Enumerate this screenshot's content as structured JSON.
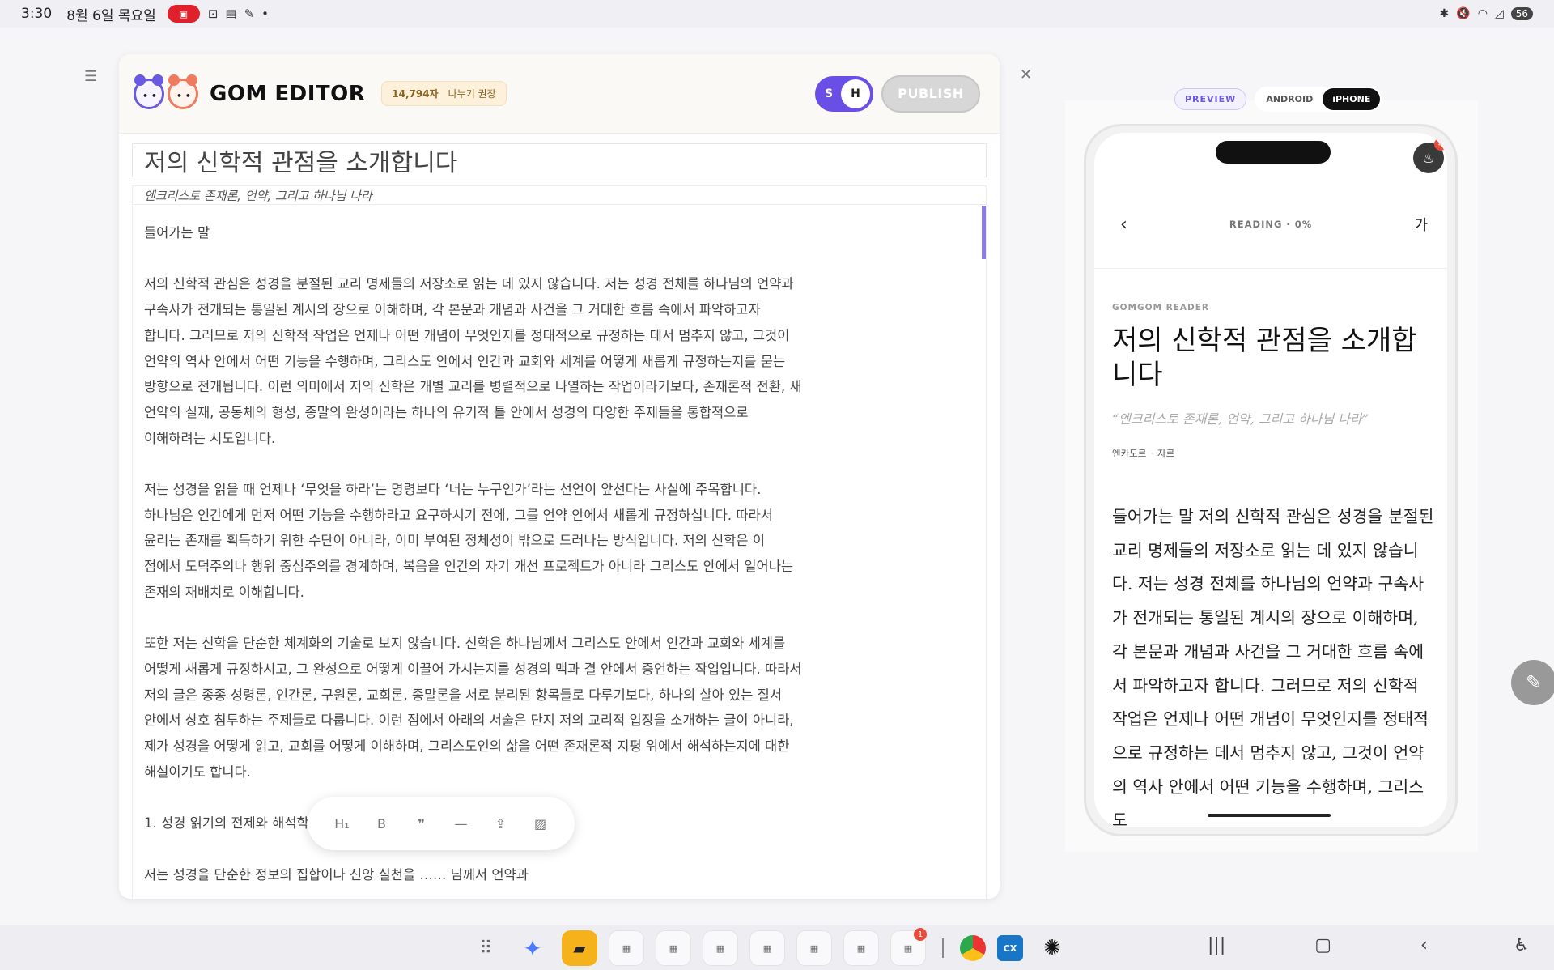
{
  "status_bar": {
    "time": "3:30",
    "date": "8월 6일 목요일",
    "battery": "56"
  },
  "editor": {
    "logo": "GOM EDITOR",
    "word_count": "14,794자",
    "font_hint": "나누기 권장",
    "toggle": {
      "left": "S",
      "right": "H"
    },
    "publish_label": "PUBLISH",
    "title": "저의 신학적 관점을 소개합니다",
    "subtitle": "엔크리스토 존재론, 언약, 그리고 하나님 나라",
    "paragraphs": [
      "들어가는 말",
      "저의 신학적 관심은 성경을 분절된 교리 명제들의 저장소로 읽는 데 있지 않습니다. 저는 성경 전체를 하나님의 언약과\n구속사가 전개되는 통일된 계시의 장으로 이해하며, 각 본문과 개념과 사건을 그 거대한 흐름 속에서 파악하고자\n합니다. 그러므로 저의 신학적 작업은 언제나 어떤 개념이 무엇인지를 정태적으로 규정하는 데서 멈추지 않고, 그것이\n언약의 역사 안에서 어떤 기능을 수행하며, 그리스도 안에서 인간과 교회와 세계를 어떻게 새롭게 규정하는지를 묻는\n방향으로 전개됩니다. 이런 의미에서 저의 신학은 개별 교리를 병렬적으로 나열하는 작업이라기보다, 존재론적 전환, 새\n언약의 실재, 공동체의 형성, 종말의 완성이라는 하나의 유기적 틀 안에서 성경의 다양한 주제들을 통합적으로\n이해하려는 시도입니다.",
      "저는 성경을 읽을 때 언제나 ‘무엇을 하라’는 명령보다 ‘너는 누구인가’라는 선언이 앞선다는 사실에 주목합니다.\n하나님은 인간에게 먼저 어떤 기능을 수행하라고 요구하시기 전에, 그를 언약 안에서 새롭게 규정하십니다. 따라서\n윤리는 존재를 획득하기 위한 수단이 아니라, 이미 부여된 정체성이 밖으로 드러나는 방식입니다. 저의 신학은 이\n점에서 도덕주의나 행위 중심주의를 경계하며, 복음을 인간의 자기 개선 프로젝트가 아니라 그리스도 안에서 일어나는\n존재의 재배치로 이해합니다.",
      "또한 저는 신학을 단순한 체계화의 기술로 보지 않습니다. 신학은 하나님께서 그리스도 안에서 인간과 교회와 세계를\n어떻게 새롭게 규정하시고, 그 완성으로 어떻게 이끌어 가시는지를 성경의 맥과 결 안에서 증언하는 작업입니다. 따라서\n저의 글은 종종 성령론, 인간론, 구원론, 교회론, 종말론을 서로 분리된 항목들로 다루기보다, 하나의 살아 있는 질서\n안에서 상호 침투하는 주제들로 다룹니다. 이런 점에서 아래의 서술은 단지 저의 교리적 입장을 소개하는 글이 아니라,\n제가 성경을 어떻게 읽고, 교회를 어떻게 이해하며, 그리스도인의 삶을 어떤 존재론적 지평 위에서 해석하는지에 대한\n해설이기도 합니다.",
      "1. 성경 읽기의 전제와 해석학적 방법",
      "저는 성경을 단순한 정보의 집합이나 신앙 실천을 …… 님께서 언약과"
    ],
    "toolbar": [
      "H1",
      "B",
      "99",
      "—",
      "upload",
      "image"
    ]
  },
  "preview": {
    "preview_label": "PREVIEW",
    "android_label": "ANDROID",
    "iphone_label": "iPHONE",
    "active_device": "iPHONE",
    "notification_count": "4",
    "reading_progress": "READING · 0%",
    "font_button": "가",
    "kicker": "GOMGOM READER",
    "title": "저의 신학적 관점을 소개합니다",
    "subtitle": "“엔크리스토 존재론, 언약, 그리고 하나님 나라”",
    "meta_author": "엔카도르",
    "meta_type": "자르",
    "body": "들어가는 말 저의 신학적 관심은 성경을 분절된 교리 명제들의 저장소로 읽는 데 있지 않습니다. 저는 성경 전체를 하나님의 언약과 구속사가 전개되는 통일된 계시의 장으로 이해하며, 각 본문과 개념과 사건을 그 거대한 흐름 속에서 파악하고자 합니다. 그러므로 저의 신학적 작업은 언제나 어떤 개념이 무엇인지를 정태적으로 규정하는 데서 멈추지 않고, 그것이 언약의 역사 안에서 어떤 기능을 수행하며, 그리스도"
  },
  "dock": {
    "apps": [
      "grid-icon",
      "gemini-icon",
      "yellow-app",
      "folder-1",
      "folder-2",
      "folder-3",
      "folder-4",
      "folder-5",
      "folder-6",
      "folder-7",
      "chrome",
      "cx",
      "chatgpt"
    ],
    "folder7_badge": "1"
  },
  "colors": {
    "accent": "#6a4fe6",
    "publish_disabled": "#d7d7d7",
    "badge_bg": "#fdf1dc"
  }
}
